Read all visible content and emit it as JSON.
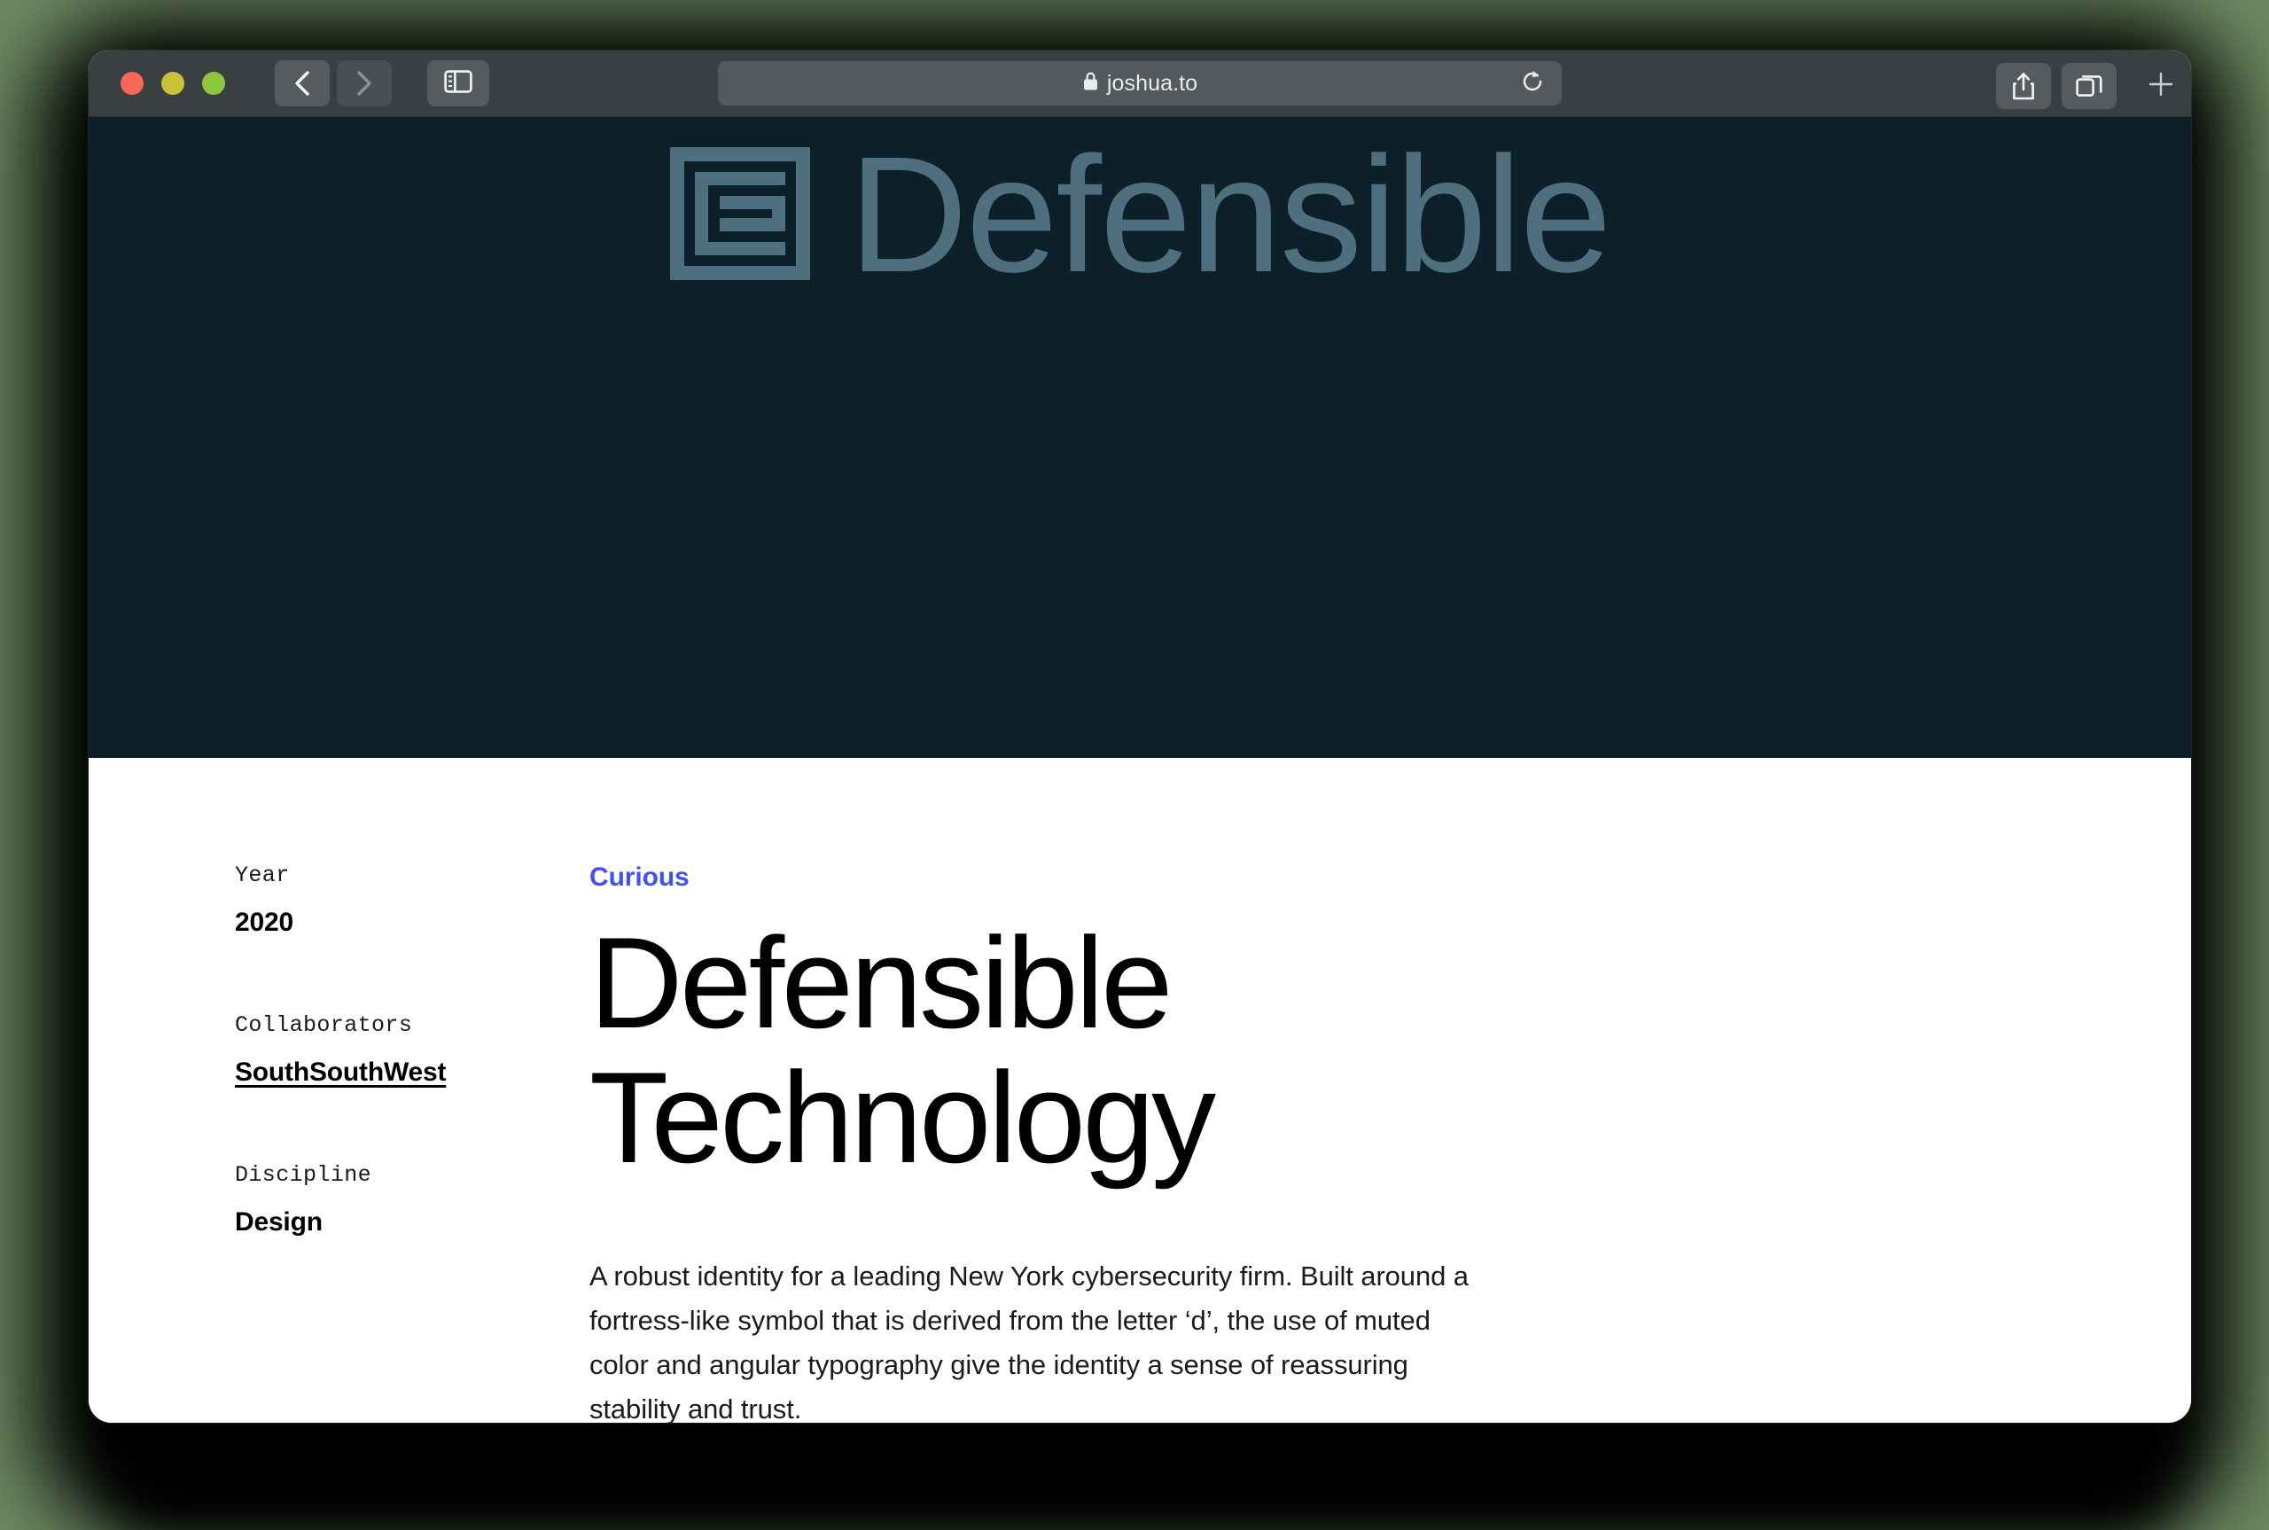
{
  "browser": {
    "traffic_lights": [
      {
        "name": "close",
        "color": "#f9665a"
      },
      {
        "name": "minimize",
        "color": "#c8c336"
      },
      {
        "name": "maximize",
        "color": "#8ec73f"
      }
    ],
    "back_label": "Back",
    "forward_label": "Forward",
    "sidebar_label": "Show Sidebar",
    "address": {
      "url": "joshua.to",
      "placeholder": "Search or enter website name",
      "secure": true,
      "reload_label": "Reload"
    },
    "share_label": "Share",
    "tabs_label": "Tab Overview",
    "new_tab_label": "+"
  },
  "hero": {
    "background": "#0d1f28",
    "logo_color": "#4e6f7d",
    "wordmark": "Defensible",
    "mark_name": "defensible-fortress-logomark"
  },
  "meta": {
    "items": [
      {
        "label": "Year",
        "value": "2020",
        "link": false
      },
      {
        "label": "Collaborators",
        "value": "SouthSouthWest",
        "link": true
      },
      {
        "label": "Discipline",
        "value": "Design",
        "link": false
      }
    ]
  },
  "article": {
    "eyebrow": "Curious",
    "eyebrow_color": "#4250f4",
    "headline": "Defensible Technology",
    "body": "A robust identity for a leading New York cybersecurity firm. Built around a fortress-like symbol that is derived from the letter ‘d’, the use of muted color and angular typography give the identity a sense of reassuring stability and trust."
  }
}
